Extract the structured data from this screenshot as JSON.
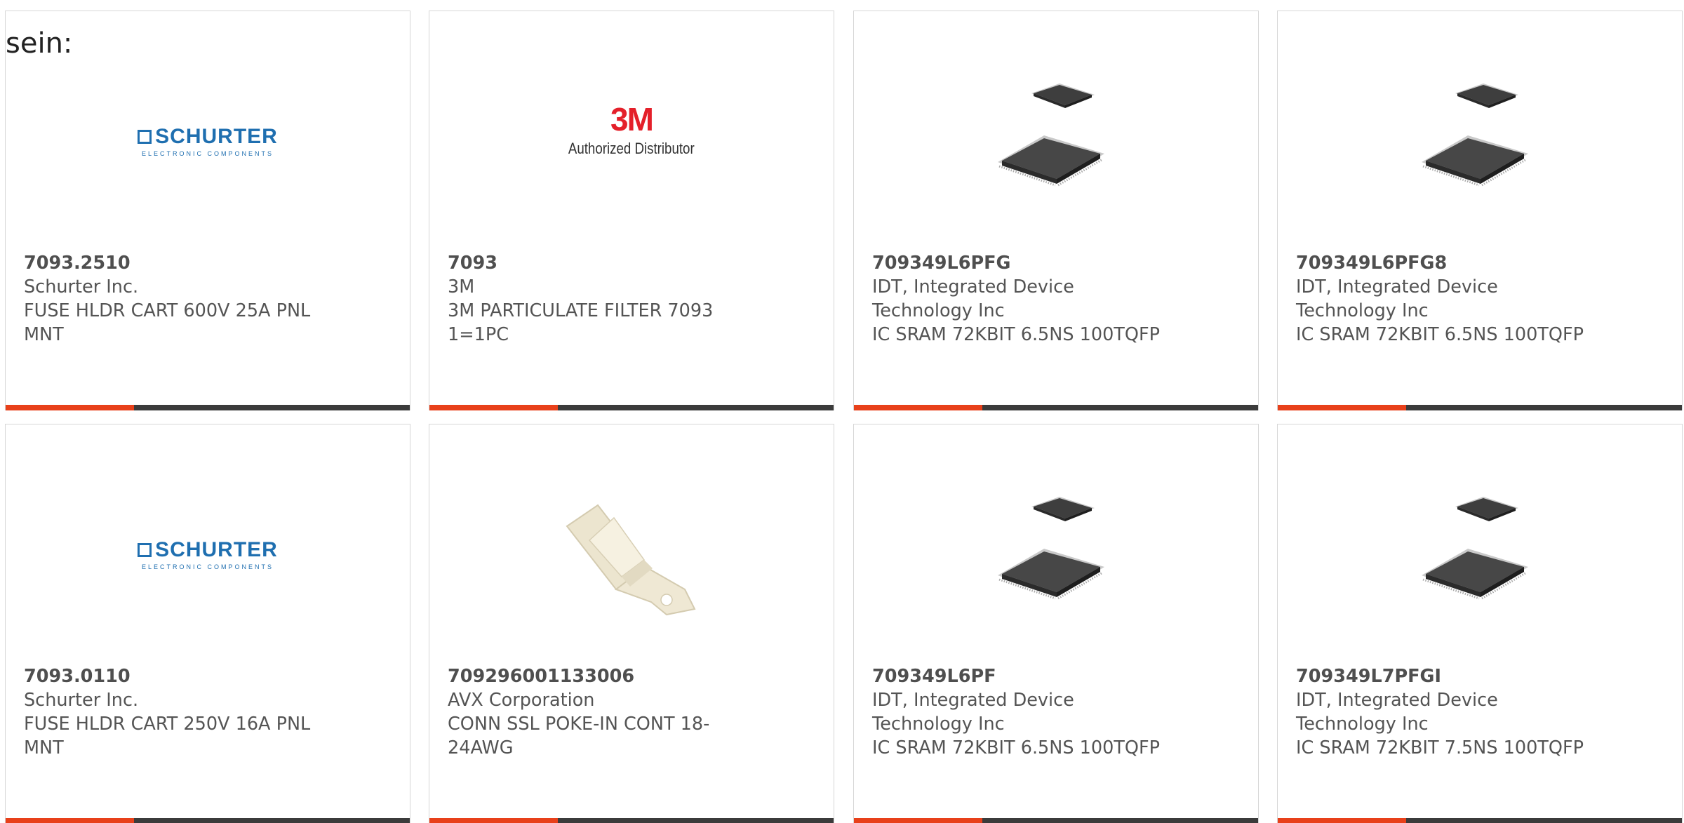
{
  "stray_text": "sein:",
  "colors": {
    "accent": "#e8401a",
    "bar": "#3b3b3b",
    "border": "#d6d6d6",
    "text": "#545454",
    "schurter_blue": "#1f6fb0",
    "brand_3m_red": "#e4202a"
  },
  "products": [
    {
      "part_number": "7093.2510",
      "manufacturer": "Schurter Inc.",
      "description": "FUSE HLDR CART 600V 25A PNL MNT",
      "image": "schurter-logo",
      "logo_title": "SCHURTER",
      "logo_subtitle": "ELECTRONIC COMPONENTS"
    },
    {
      "part_number": "7093",
      "manufacturer": "3M",
      "description": "3M PARTICULATE FILTER 7093 1=1PC",
      "image": "3m-logo",
      "logo_title": "3M",
      "logo_subtitle": "Authorized Distributor"
    },
    {
      "part_number": "709349L6PFG",
      "manufacturer": "IDT, Integrated Device Technology Inc",
      "description": "IC SRAM 72KBIT 6.5NS 100TQFP",
      "image": "tqfp-chip-photo"
    },
    {
      "part_number": "709349L6PFG8",
      "manufacturer": "IDT, Integrated Device Technology Inc",
      "description": "IC SRAM 72KBIT 6.5NS 100TQFP",
      "image": "tqfp-chip-photo"
    },
    {
      "part_number": "7093.0110",
      "manufacturer": "Schurter Inc.",
      "description": "FUSE HLDR CART 250V 16A PNL MNT",
      "image": "schurter-logo",
      "logo_title": "SCHURTER",
      "logo_subtitle": "ELECTRONIC COMPONENTS"
    },
    {
      "part_number": "709296001133006",
      "manufacturer": "AVX Corporation",
      "description": "CONN SSL POKE-IN CONT 18-24AWG",
      "image": "contact-clip-photo"
    },
    {
      "part_number": "709349L6PF",
      "manufacturer": "IDT, Integrated Device Technology Inc",
      "description": "IC SRAM 72KBIT 6.5NS 100TQFP",
      "image": "tqfp-chip-photo"
    },
    {
      "part_number": "709349L7PFGI",
      "manufacturer": "IDT, Integrated Device Technology Inc",
      "description": "IC SRAM 72KBIT 7.5NS 100TQFP",
      "image": "tqfp-chip-photo"
    }
  ]
}
